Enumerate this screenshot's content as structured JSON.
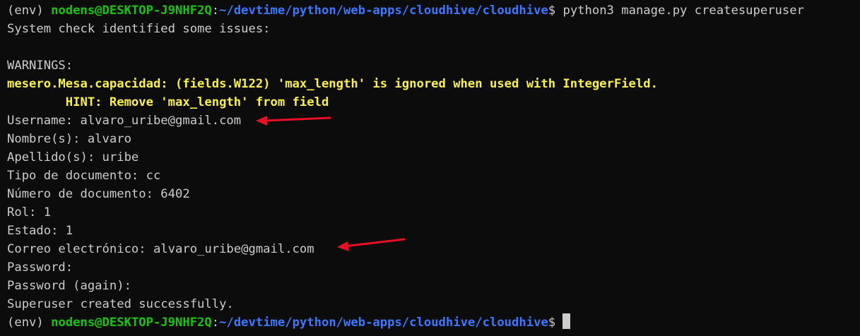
{
  "prompt": {
    "env": "(env) ",
    "user_host": "nodens@DESKTOP-J9NHF2Q",
    "separator": ":",
    "path": "~/devtime/python/web-apps/cloudhive/cloudhive",
    "dollar": "$"
  },
  "command": " python3 manage.py createsuperuser",
  "output": {
    "system_check": "System check identified some issues:",
    "warnings_header": "WARNINGS:",
    "warning": "mesero.Mesa.capacidad: (fields.W122) 'max_length' is ignored when used with IntegerField.",
    "hint": "        HINT: Remove 'max_length' from field",
    "username": "Username: alvaro_uribe@gmail.com",
    "nombres": "Nombre(s): alvaro",
    "apellidos": "Apellido(s): uribe",
    "tipo_documento": "Tipo de documento: cc",
    "numero_documento": "Número de documento: 6402",
    "rol": "Rol: 1",
    "estado": "Estado: 1",
    "correo": "Correo electrónico: alvaro_uribe@gmail.com",
    "password": "Password:",
    "password_again": "Password (again):",
    "success": "Superuser created successfully."
  },
  "colors": {
    "background": "#0c0c0c",
    "text": "#cccccc",
    "user_host": "#16c60c",
    "path": "#3b78ff",
    "warning": "#f9f149",
    "annotation_arrow": "#e81123"
  }
}
